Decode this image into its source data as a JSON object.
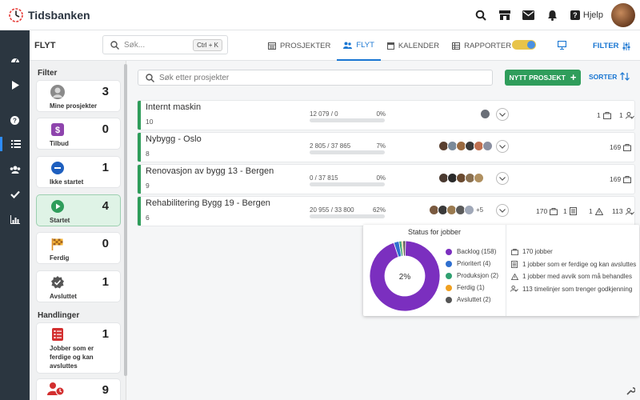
{
  "app": {
    "name": "Tidsbanken",
    "help_label": "Hjelp"
  },
  "subheader": {
    "title": "FLYT",
    "search_placeholder": "Søk...",
    "shortcut": "Ctrl + K",
    "tabs": [
      {
        "label": "PROSJEKTER",
        "icon": "projects-icon",
        "active": false
      },
      {
        "label": "FLYT",
        "icon": "users-icon",
        "active": true
      },
      {
        "label": "KALENDER",
        "icon": "calendar-icon",
        "active": false
      },
      {
        "label": "RAPPORTER",
        "icon": "report-icon",
        "active": false
      }
    ],
    "filter_label": "FILTER"
  },
  "filter_panel": {
    "filter_heading": "Filter",
    "actions_heading": "Handlinger",
    "filters": [
      {
        "label": "Mine prosjekter",
        "count": "3",
        "icon": "user-avatar-icon",
        "active": false
      },
      {
        "label": "Tilbud",
        "count": "0",
        "icon": "money-envelope-icon",
        "active": false
      },
      {
        "label": "Ikke startet",
        "count": "1",
        "icon": "minus-circle-icon",
        "active": false
      },
      {
        "label": "Startet",
        "count": "4",
        "icon": "play-circle-icon",
        "active": true
      },
      {
        "label": "Ferdig",
        "count": "0",
        "icon": "checkered-flag-icon",
        "active": false
      },
      {
        "label": "Avsluttet",
        "count": "1",
        "icon": "check-badge-icon",
        "active": false
      }
    ],
    "actions": [
      {
        "label": "Jobber som er ferdige og kan avsluttes",
        "count": "1",
        "icon": "task-list-icon"
      },
      {
        "label": "",
        "count": "9",
        "icon": "user-clock-icon"
      }
    ]
  },
  "main": {
    "search_placeholder": "Søk etter prosjekter",
    "new_project_label": "NYTT PROSJEKT",
    "sort_label": "SORTER",
    "projects": [
      {
        "name": "Internt maskin",
        "number": "10",
        "hours": "12 079 / 0",
        "percent": "0%",
        "progress": 0,
        "avatars": 1,
        "more": "",
        "stats": [
          "1",
          "1"
        ]
      },
      {
        "name": "Nybygg - Oslo",
        "number": "8",
        "hours": "2 805 / 37 865",
        "percent": "7%",
        "progress": 0.07,
        "avatars": 6,
        "more": "",
        "stats": [
          "169"
        ]
      },
      {
        "name": "Renovasjon av bygg 13 - Bergen",
        "number": "9",
        "hours": "0 / 37 815",
        "percent": "0%",
        "progress": 0,
        "avatars": 5,
        "more": "",
        "stats": [
          "169"
        ]
      },
      {
        "name": "Rehabilitering Bygg 19 - Bergen",
        "number": "6",
        "hours": "20 955 / 33 800",
        "percent": "62%",
        "progress": 0.62,
        "avatars": 5,
        "more": "+5",
        "stats": [
          "170",
          "1",
          "1",
          "113"
        ]
      }
    ]
  },
  "popup": {
    "title": "Status for jobber",
    "center_label": "2%",
    "legend": [
      {
        "label": "Backlog (158)",
        "color": "#7b2fbf",
        "value": 158
      },
      {
        "label": "Prioritert (4)",
        "color": "#2f6fcf",
        "value": 4
      },
      {
        "label": "Produksjon (2)",
        "color": "#2fa070",
        "value": 2
      },
      {
        "label": "Ferdig (1)",
        "color": "#f0a020",
        "value": 1
      },
      {
        "label": "Avsluttet (2)",
        "color": "#555555",
        "value": 2
      }
    ],
    "info": [
      {
        "label": "170 jobber",
        "icon": "briefcase-icon"
      },
      {
        "label": "1 jobber som er ferdige og kan avsluttes",
        "icon": "document-icon"
      },
      {
        "label": "1 jobber med avvik som må behandles",
        "icon": "warning-icon"
      },
      {
        "label": "113 timelinjer som trenger godkjenning",
        "icon": "user-check-icon"
      }
    ]
  }
}
